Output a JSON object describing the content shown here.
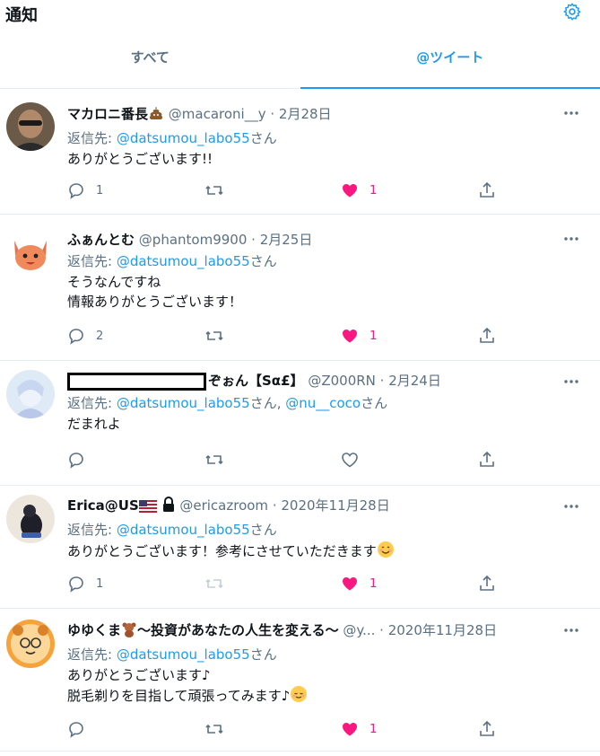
{
  "header": {
    "title": "通知"
  },
  "tabs": [
    {
      "label": "すべて",
      "active": false
    },
    {
      "label": "@ツイート",
      "active": true
    }
  ],
  "colors": {
    "accent": "#1d9bf0",
    "like": "#f91880",
    "muted": "#5b7083",
    "border": "#e6ecf0"
  },
  "tweets": [
    {
      "name": "マカロニ番長",
      "name_emoji": "pile-of-poo",
      "handle": "@macaroni__y",
      "date": "2月28日",
      "reply_prefix": "返信先: ",
      "reply_to": [
        "@datsumou_labo55"
      ],
      "reply_suffix": "さん",
      "text": "ありがとうございます!!",
      "replies": "1",
      "liked": true,
      "likes": "1"
    },
    {
      "name": "ふぁんとむ",
      "handle": "@phantom9900",
      "date": "2月25日",
      "reply_prefix": "返信先: ",
      "reply_to": [
        "@datsumou_labo55"
      ],
      "reply_suffix": "さん",
      "text": "そうなんですね\n情報ありがとうございます！",
      "replies": "2",
      "liked": true,
      "likes": "1"
    },
    {
      "name": "ぞぉん【Sα£】",
      "name_redacted": true,
      "handle": "@Z000RN",
      "date": "2月24日",
      "reply_prefix": "返信先: ",
      "reply_to": [
        "@datsumou_labo55",
        "@nu__coco"
      ],
      "reply_suffix": "さん",
      "reply_separator": "さん, ",
      "text": "だまれよ",
      "replies": "",
      "liked": false,
      "likes": ""
    },
    {
      "name": "Erica@US",
      "name_emoji": "us-flag lock",
      "handle": "@ericazroom",
      "date": "2020年11月28日",
      "reply_prefix": "返信先: ",
      "reply_to": [
        "@datsumou_labo55"
      ],
      "reply_suffix": "さん",
      "text": "ありがとうございます！参考にさせていただきます",
      "text_emoji": "smiling-face",
      "replies": "1",
      "liked": true,
      "likes": "1"
    },
    {
      "name": "ゆゆくま",
      "name_emoji": "teddy-bear",
      "name_suffix": "～投資があなたの人生を変える～",
      "handle": "@y...",
      "date": "2020年11月28日",
      "reply_prefix": "返信先: ",
      "reply_to": [
        "@datsumou_labo55"
      ],
      "reply_suffix": "さん",
      "text": "ありがとうございます♪\n脱毛剃りを目指して頑張ってみます♪",
      "text_emoji": "relieved-face",
      "replies": "",
      "liked": true,
      "likes": "1"
    }
  ]
}
